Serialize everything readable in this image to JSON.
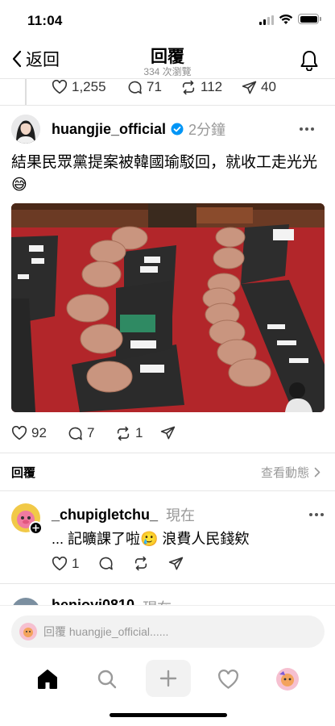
{
  "status_bar": {
    "time": "11:04"
  },
  "nav": {
    "back_label": "返回",
    "title": "回覆",
    "views": "334 次瀏覽"
  },
  "parent_stats": {
    "likes": "1,255",
    "comments": "71",
    "reposts": "112",
    "shares": "40"
  },
  "post": {
    "username": "huangjie_official",
    "verified": true,
    "time": "2分鐘",
    "text": "結果民眾黨提案被韓國瑜駁回，就收工走光光😅",
    "image_alt": "legislature chamber with empty seats",
    "stats": {
      "likes": "92",
      "comments": "7",
      "reposts": "1"
    }
  },
  "replies_section": {
    "label": "回覆",
    "activity_label": "查看動態"
  },
  "reply": {
    "username": "_chupigletchu_",
    "time": "現在",
    "text": "... 記曠課了啦🥲 浪費人民錢欸",
    "likes": "1"
  },
  "next_reply": {
    "username": "henjoyi0810",
    "time": "現在"
  },
  "reply_input": {
    "placeholder": "回覆 huangjie_official......"
  },
  "colors": {
    "accent_verified": "#0095f6",
    "seat": "#c9957f",
    "carpet": "#b2262a",
    "desk": "#2c2c2c"
  },
  "tabs": [
    "home-icon",
    "search-icon",
    "create-icon",
    "activity-icon",
    "profile-icon"
  ]
}
